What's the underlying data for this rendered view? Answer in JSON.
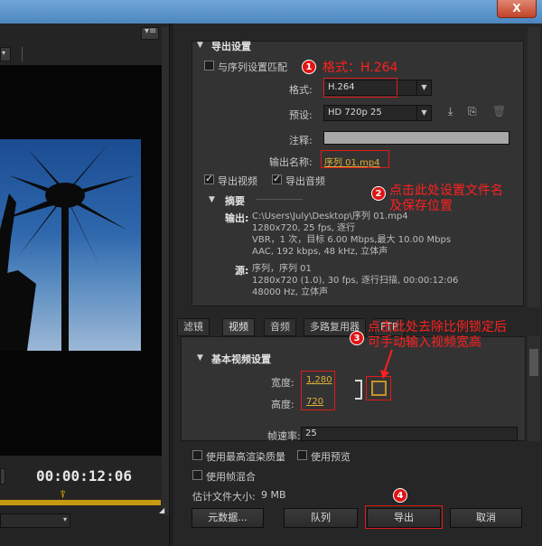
{
  "window": {
    "close_label": "X"
  },
  "left": {
    "timecode": "00:00:12:06",
    "menu_icon": "panel-menu-icon"
  },
  "export_settings": {
    "section_title": "导出设置",
    "match_sequence_label": "与序列设置匹配",
    "format_label": "格式:",
    "format_value": "H.264",
    "preset_label": "预设:",
    "preset_value": "HD 720p 25",
    "comments_label": "注释:",
    "output_name_label": "输出名称:",
    "output_name_value": "序列 01.mp4",
    "export_video_label": "导出视频",
    "export_audio_label": "导出音频",
    "export_video_checked": true,
    "export_audio_checked": true,
    "match_sequence_checked": false
  },
  "summary": {
    "title": "摘要",
    "output_key": "输出:",
    "output_lines": [
      "C:\\Users\\July\\Desktop\\序列 01.mp4",
      "1280x720, 25 fps, 逐行",
      "VBR，1 次，目标 6.00 Mbps,最大 10.00 Mbps",
      "AAC, 192 kbps, 48 kHz, 立体声"
    ],
    "source_key": "源:",
    "source_lines": [
      "序列，序列 01",
      "1280x720 (1.0), 30 fps, 逐行扫描, 00:00:12:06",
      "48000 Hz, 立体声"
    ]
  },
  "tabs": [
    "滤镜",
    "视频",
    "音频",
    "多路复用器",
    "FTP"
  ],
  "active_tab": "视频",
  "video": {
    "section_title": "基本视频设置",
    "width_label": "宽度:",
    "width_value": "1,280",
    "height_label": "高度:",
    "height_value": "720",
    "framerate_label": "帧速率:",
    "framerate_value": "25"
  },
  "bottom": {
    "max_render_label": "使用最高渲染质量",
    "use_preview_label": "使用预览",
    "frame_blend_label": "使用帧混合",
    "file_size_label": "估计文件大小:",
    "file_size_value": "9 MB",
    "metadata_button": "元数据...",
    "queue_button": "队列",
    "export_button": "导出",
    "cancel_button": "取消"
  },
  "annotations": {
    "a1_num": "1",
    "a1_text": "格式：H.264",
    "a2_num": "2",
    "a2_line1": "点击此处设置文件名",
    "a2_line2": "及保存位置",
    "a3_num": "3",
    "a3_line1": "点击此处去除比例锁定后",
    "a3_line2": "可手动输入视频宽高",
    "a4_num": "4",
    "color": "#ff2020"
  }
}
